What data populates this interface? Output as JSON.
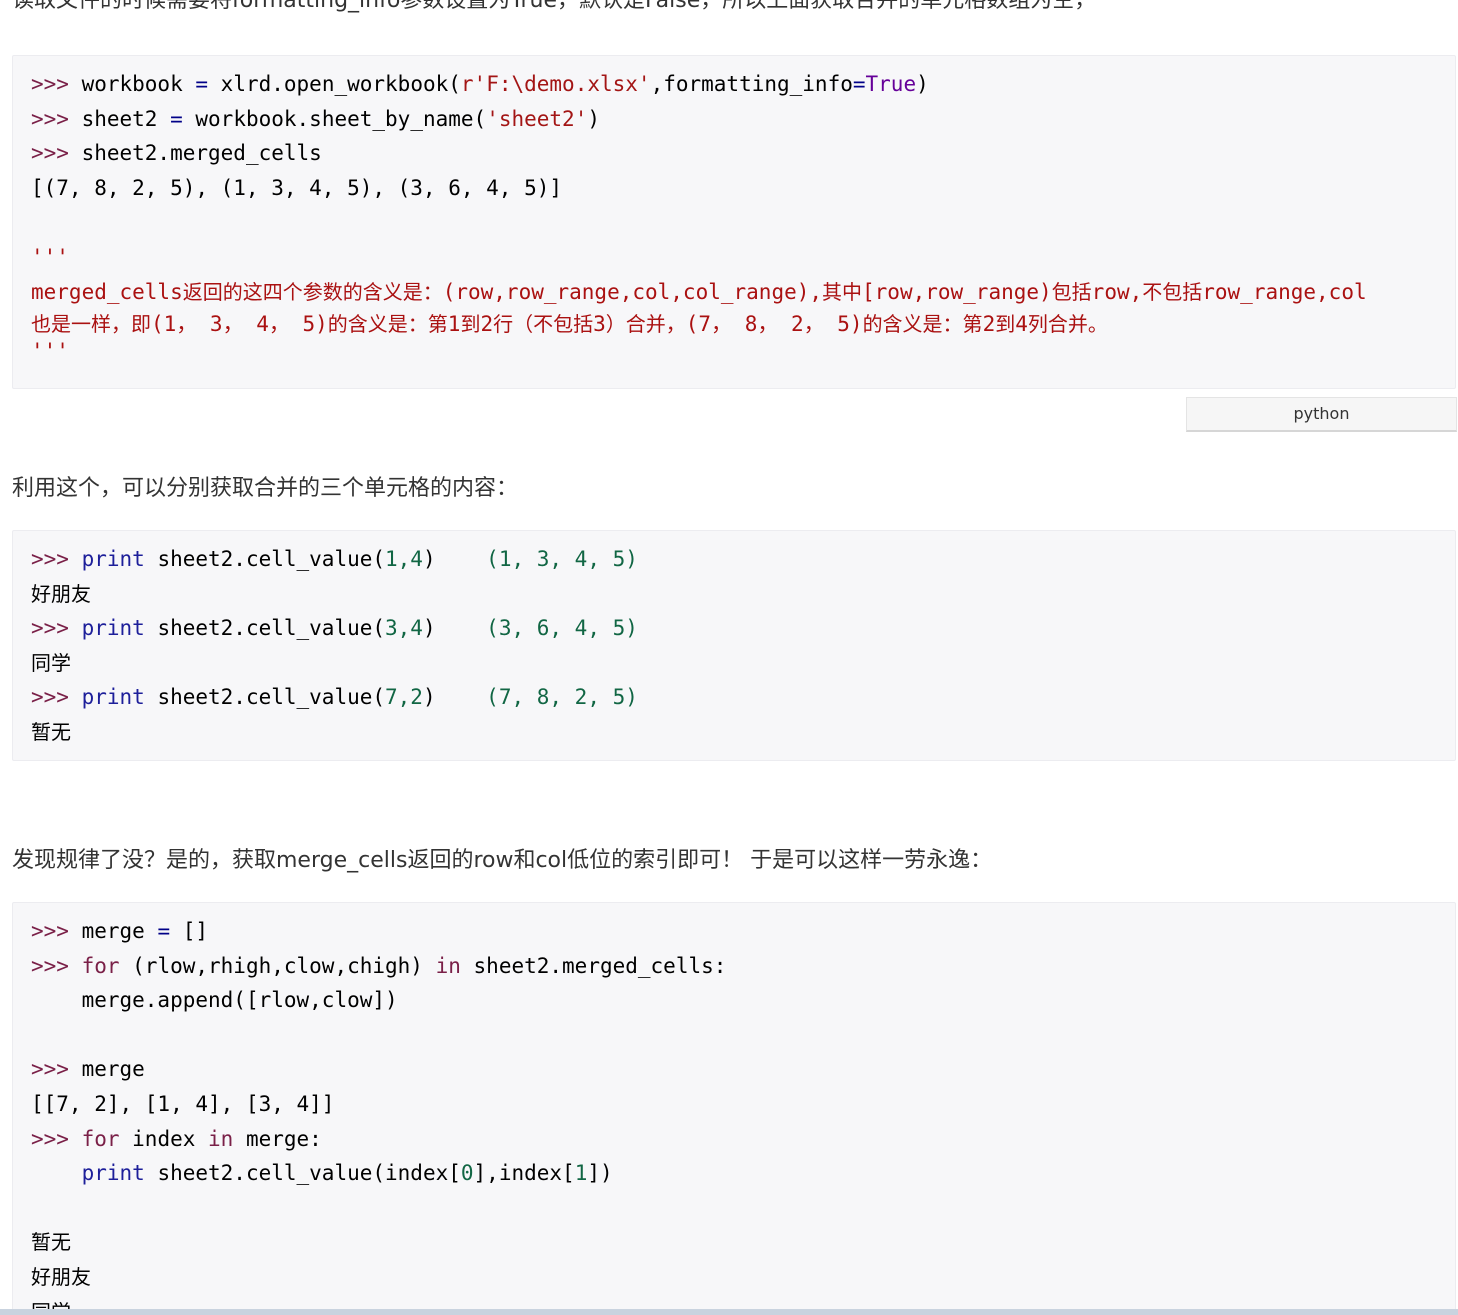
{
  "intro_cut": "读取文件的时候需要将formatting_info参数设置为True，默认是False，所以上面获取合并的单元格数组为空，",
  "block1": {
    "l1_prompt": ">>> ",
    "l1_a": "workbook ",
    "l1_eq": "=",
    "l1_b": " xlrd.open_workbook(",
    "l1_str": "r'F:\\demo.xlsx'",
    "l1_c": ",formatting_info",
    "l1_eq2": "=",
    "l1_bool": "True",
    "l1_d": ")",
    "l2_prompt": ">>> ",
    "l2_a": "sheet2 ",
    "l2_eq": "=",
    "l2_b": " workbook.sheet_by_name(",
    "l2_str": "'sheet2'",
    "l2_c": ")",
    "l3_prompt": ">>> ",
    "l3_a": "sheet2.merged_cells",
    "l4": "[(7, 8, 2, 5), (1, 3, 4, 5), (3, 6, 4, 5)]",
    "q_open": "'''",
    "c1_a": "merged_cells",
    "c1_b": "返回的这四个参数的含义是：",
    "c1_c": "(row,row_range,col,col_range),",
    "c1_d": "其中",
    "c1_e": "[row,row_range)",
    "c1_f": "包括",
    "c1_g": "row,",
    "c1_h": "不包括",
    "c1_i": "row_range,col",
    "c2_a": "也是一样，即",
    "c2_b": "(1， 3， 4， 5)",
    "c2_c": "的含义是：第",
    "c2_d": "1",
    "c2_e": "到",
    "c2_f": "2",
    "c2_g": "行（不包括",
    "c2_h": "3",
    "c2_i": "）合并，",
    "c2_j": "(7， 8， 2， 5)",
    "c2_k": "的含义是：第",
    "c2_l": "2",
    "c2_m": "到",
    "c2_n": "4",
    "c2_o": "列合并。",
    "q_close": "'''"
  },
  "lang_label": "python",
  "para2": "利用这个，可以分别获取合并的三个单元格的内容：",
  "block2": {
    "prompt": ">>> ",
    "print_kw": "print",
    "r1_call": " sheet2.cell_value(",
    "r1_args": "1,4",
    "r1_close": ")",
    "r1_tuple": "    (1, 3, 4, 5)",
    "r1_out": "好朋友",
    "r2_args": "3,4",
    "r2_tuple": "    (3, 6, 4, 5)",
    "r2_out": "同学",
    "r3_args": "7,2",
    "r3_tuple": "    (7, 8, 2, 5)",
    "r3_out": "暂无"
  },
  "para3": "发现规律了没？是的，获取merge_cells返回的row和col低位的索引即可！ 于是可以这样一劳永逸：",
  "block3": {
    "prompt": ">>> ",
    "m1_a": "merge ",
    "m1_eq": "=",
    "m1_b": " []",
    "for_kw": "for",
    "m2_a": " (rlow,rhigh,clow,chigh) ",
    "in_kw": "in",
    "m2_b": " sheet2.merged_cells:",
    "m3_indent": "    ",
    "m3_a": "merge.append([rlow,clow])",
    "m4_a": "merge",
    "m5": "[[7, 2], [1, 4], [3, 4]]",
    "m6_a": " index ",
    "m6_b": " merge:",
    "print_kw": "print",
    "m7_a": " sheet2.cell_value(index[",
    "m7_n0": "0",
    "m7_b": "],index[",
    "m7_n1": "1",
    "m7_c": "])",
    "o1": "暂无",
    "o2": "好朋友",
    "o3": "同学"
  }
}
